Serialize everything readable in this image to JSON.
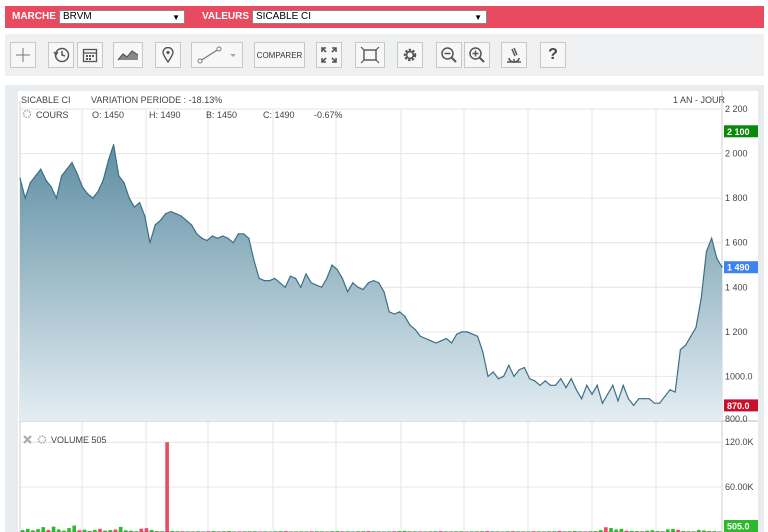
{
  "topbar": {
    "market_label": "MARCHE",
    "market_value": "BRVM",
    "values_label": "VALEURS",
    "values_value": "SICABLE CI"
  },
  "toolbar": {
    "compare_label": "COMPARER",
    "help_label": "?"
  },
  "chart_header": {
    "symbol": "SICABLE CI",
    "variation": "VARIATION PERIODE : -18.13%",
    "period": "1 AN - JOUR",
    "series_label": "COURS",
    "open": "O: 1450",
    "high": "H: 1490",
    "low": "B: 1450",
    "close": "C: 1490",
    "change": "-0.67%"
  },
  "volume_header": {
    "label": "VOLUME 505"
  },
  "colors": {
    "topbar": "#e84a5f",
    "area_top": "#5e8ea3",
    "area_bottom": "#e4eef3",
    "line": "#3e6f86",
    "last_price": "#3d82f0",
    "max_badge": "#0a8a0a",
    "min_badge": "#c8102e",
    "volume_up": "#2eb82e",
    "volume_down": "#e84a5f"
  },
  "chart_data": [
    {
      "type": "area",
      "series": [
        {
          "name": "COURS",
          "values": [
            1890,
            1800,
            1870,
            1900,
            1930,
            1880,
            1850,
            1800,
            1900,
            1930,
            1960,
            1910,
            1850,
            1820,
            1800,
            1830,
            1880,
            1970,
            2040,
            1900,
            1870,
            1800,
            1760,
            1780,
            1720,
            1600,
            1680,
            1700,
            1730,
            1740,
            1730,
            1720,
            1700,
            1680,
            1640,
            1620,
            1610,
            1630,
            1620,
            1630,
            1620,
            1600,
            1640,
            1640,
            1620,
            1520,
            1440,
            1430,
            1430,
            1440,
            1420,
            1400,
            1450,
            1440,
            1400,
            1460,
            1420,
            1410,
            1400,
            1440,
            1500,
            1480,
            1440,
            1380,
            1420,
            1400,
            1390,
            1420,
            1430,
            1420,
            1380,
            1290,
            1280,
            1290,
            1270,
            1230,
            1210,
            1180,
            1170,
            1160,
            1150,
            1160,
            1170,
            1150,
            1190,
            1200,
            1200,
            1190,
            1180,
            1110,
            1000,
            1020,
            990,
            1000,
            1050,
            1000,
            1030,
            1040,
            990,
            980,
            960,
            980,
            960,
            960,
            990,
            950,
            990,
            940,
            900,
            960,
            920,
            960,
            880,
            920,
            960,
            890,
            960,
            900,
            870,
            900,
            900,
            900,
            880,
            880,
            910,
            940,
            930,
            1120,
            1140,
            1180,
            1220,
            1350,
            1560,
            1620,
            1530,
            1490
          ],
          "markers": {
            "max_badge": 2100,
            "last": 1490,
            "min_badge": 870
          }
        }
      ],
      "ylim": [
        800,
        2200
      ],
      "y_ticks": [
        2200,
        2000,
        1800,
        1600,
        1400,
        1200,
        1000
      ],
      "y_tick_labels": [
        "2 200",
        "2 000",
        "1 800",
        "1 600",
        "1 400",
        "1 200",
        "1000.0"
      ],
      "bottom_tick_label": "800.0",
      "marker_labels": {
        "max": "2 100",
        "last": "1 490",
        "min": "870.0"
      }
    },
    {
      "type": "bar",
      "series": [
        {
          "name": "VOLUME",
          "values": [
            2500,
            4100,
            2200,
            3800,
            6500,
            2800,
            7200,
            3500,
            1800,
            5200,
            8600,
            2400,
            3100,
            1500,
            2800,
            4200,
            1900,
            2600,
            3300,
            6800,
            2300,
            1800,
            900,
            4400,
            5100,
            2700,
            1300,
            900,
            120000,
            1400,
            900,
            800,
            600,
            700,
            900,
            500,
            800,
            1200,
            700,
            900,
            1300,
            500,
            600,
            700,
            800,
            900,
            500,
            600,
            400,
            800,
            1000,
            1200,
            500,
            600,
            700,
            600,
            800,
            900,
            700,
            500,
            900,
            1100,
            700,
            800,
            600,
            900,
            1000,
            1200,
            800,
            700,
            500,
            600,
            900,
            1200,
            1500,
            800,
            700,
            600,
            500,
            700,
            900,
            1100,
            700,
            600,
            800,
            900,
            500,
            600,
            800,
            900,
            1200,
            700,
            600,
            400,
            800,
            1000,
            700,
            600,
            500,
            900,
            700,
            600,
            800,
            900,
            1500,
            700,
            900,
            1300,
            800,
            600,
            900,
            1100,
            2500,
            6400,
            5400,
            3300,
            4200,
            1800,
            1500,
            1300,
            900,
            1800,
            2400,
            1200,
            800,
            3500,
            4100,
            2800,
            1200,
            900,
            700,
            2800,
            2100,
            1300,
            1100,
            505
          ],
          "colors": [
            "g",
            "g",
            "g",
            "g",
            "g",
            "r",
            "g",
            "g",
            "g",
            "g",
            "g",
            "r",
            "g",
            "g",
            "g",
            "r",
            "g",
            "g",
            "r",
            "g",
            "g",
            "g",
            "g",
            "r",
            "r",
            "g",
            "g",
            "g",
            "r",
            "g",
            "g",
            "r",
            "g",
            "g",
            "g",
            "g",
            "r",
            "g",
            "g",
            "g",
            "g",
            "g",
            "r",
            "g",
            "g",
            "g",
            "r",
            "g",
            "g",
            "g",
            "g",
            "r",
            "g",
            "g",
            "g",
            "g",
            "r",
            "g",
            "g",
            "g",
            "g",
            "g",
            "r",
            "g",
            "g",
            "g",
            "g",
            "r",
            "g",
            "g",
            "g",
            "g",
            "r",
            "g",
            "g",
            "g",
            "g",
            "r",
            "g",
            "g",
            "g",
            "r",
            "g",
            "g",
            "g",
            "g",
            "r",
            "g",
            "g",
            "g",
            "r",
            "g",
            "g",
            "g",
            "g",
            "r",
            "g",
            "g",
            "g",
            "r",
            "g",
            "g",
            "g",
            "g",
            "r",
            "g",
            "g",
            "g",
            "g",
            "r",
            "g",
            "g",
            "g",
            "r",
            "g",
            "g",
            "g",
            "r",
            "g",
            "g",
            "g",
            "g",
            "g",
            "g",
            "g",
            "g",
            "g",
            "r",
            "g",
            "g",
            "g",
            "g",
            "g",
            "g",
            "g",
            "g",
            "g"
          ]
        }
      ],
      "ylim": [
        0,
        135000
      ],
      "y_ticks": [
        120000,
        60000
      ],
      "y_tick_labels": [
        "120.0K",
        "60.00K"
      ],
      "marker_label": "505.0"
    }
  ]
}
